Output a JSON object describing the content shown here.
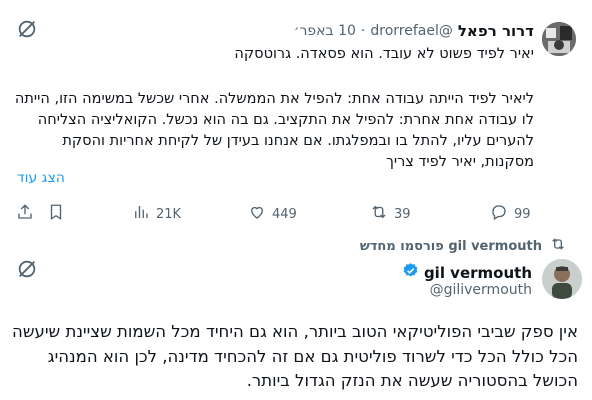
{
  "quoted_tweet": {
    "display_name": "דרור רפאל",
    "handle": "@drorrefael",
    "separator": "·",
    "date": "10 באפר׳",
    "paragraph1": "יאיר לפיד פשוט לא עובד. הוא פסאדה. גרוטסקה",
    "paragraph2": "ליאיר לפיד הייתה עבודה אחת: להפיל את הממשלה. אחרי שכשל במשימה הזו, הייתה לו עבודה אחת אחרת: להפיל את התקציב. גם בה הוא נכשל. הקואליציה הצליחה להערים עליו, להתל בו ובמפלגתו. אם אנחנו בעידן של לקיחת אחריות והסקת מסקנות, יאיר לפיד צריך",
    "show_more": "הצג עוד",
    "stats": {
      "views": "21K",
      "likes": "449",
      "reposts": "39",
      "replies": "99"
    }
  },
  "repost_notice": "gil vermouth פורסמו מחדש",
  "main_tweet": {
    "display_name": "gil vermouth",
    "handle": "@gilivermouth",
    "body": "אין ספק שביבי הפוליטיקאי הטוב ביותר, הוא גם היחיד מכל השמות שציינת שיעשה הכל כולל הכל כדי לשרוד פוליטית גם אם זה להכחיד מדינה, לכן הוא המנהיג הכושל בהסטוריה שעשה את הנזק הגדול ביותר."
  },
  "colors": {
    "text": "#0f1419",
    "muted": "#536471",
    "link": "#1d9bf0",
    "verified": "#1d9bf0"
  },
  "icons": [
    "grok-icon",
    "verified-badge-icon",
    "share-icon",
    "bookmark-icon",
    "views-icon",
    "like-icon",
    "repost-icon",
    "reply-icon"
  ]
}
